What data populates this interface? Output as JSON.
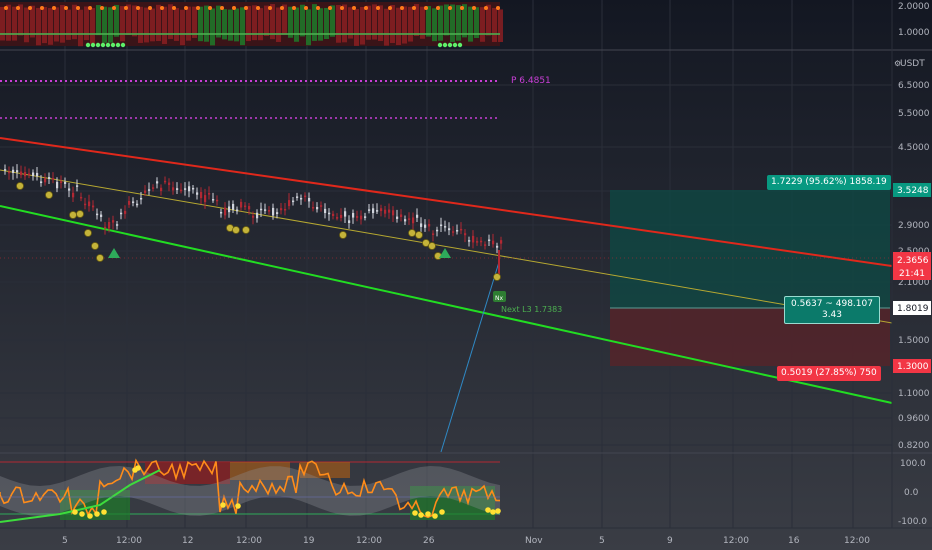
{
  "colors": {
    "background": "#131722",
    "grid": "#2a2e39",
    "channel_upper": "#e0281b",
    "channel_lower": "#22dd22",
    "midline": "#b6a831",
    "candle_up": "#d1d4dc",
    "candle_down": "#b22833",
    "profit_zone": "#0d3d3a",
    "loss_zone": "#4a1d22",
    "pivot_level": "#c83fd6",
    "oscillator_line": "#ff8c1a"
  },
  "price_axis": {
    "currency": "USDT",
    "ticks": [
      "6.5000",
      "5.5000",
      "4.5000",
      "3.5000",
      "2.9000",
      "2.5000",
      "2.1000",
      "1.8000",
      "1.5000",
      "1.3000",
      "1.1000",
      "0.9600",
      "0.8200"
    ],
    "last_price": "2.3656",
    "countdown": "21:41",
    "entry_price": "1.8019",
    "target_price": "3.5248",
    "stop_price": "1.3000"
  },
  "top_pane_axis": {
    "ticks": [
      "2.0000",
      "1.0000"
    ]
  },
  "osc_axis": {
    "ticks": [
      "100.0",
      "0.0",
      "-100.0"
    ]
  },
  "time_axis": {
    "labels": [
      "5",
      "12:00",
      "12",
      "12:00",
      "19",
      "12:00",
      "26",
      "Nov",
      "5",
      "9",
      "12:00",
      "16",
      "12:00"
    ]
  },
  "annotations": {
    "pivot": "P 6.4851",
    "next_label": "Next L3 1.7383",
    "next_badge": "Nx"
  },
  "position": {
    "profit_text": "1.7229 (95.62%) 1858.19",
    "stop_text": "0.5019 (27.85%) 750",
    "rr_line1": "0.5637 ~ 498.107",
    "rr_line2": "3.43"
  }
}
